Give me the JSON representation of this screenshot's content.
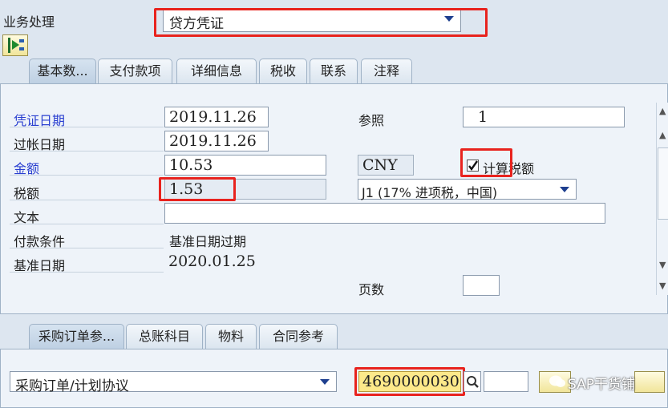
{
  "header": {
    "label": "业务处理",
    "transaction_value": "贷方凭证"
  },
  "tabs_top": [
    {
      "label": "基本数..."
    },
    {
      "label": "支付款项"
    },
    {
      "label": "详细信息"
    },
    {
      "label": "税收"
    },
    {
      "label": "联系"
    },
    {
      "label": "注释"
    }
  ],
  "basic": {
    "doc_date_label": "凭证日期",
    "doc_date": "2019.11.26",
    "post_date_label": "过帐日期",
    "post_date": "2019.11.26",
    "amount_label": "金额",
    "amount": "10.53",
    "currency": "CNY",
    "tax_label": "税额",
    "tax": "1.53",
    "text_label": "文本",
    "text_value": "",
    "payment_terms_label": "付款条件",
    "payment_terms": "基准日期过期",
    "baseline_label": "基准日期",
    "baseline_date": "2020.01.25",
    "ref_label": "参照",
    "ref_value": "1",
    "calc_tax_label": "计算税额",
    "calc_tax_checked": true,
    "tax_code": "J1 (17% 进项税，中国)",
    "page_label": "页数",
    "page_value": ""
  },
  "tabs_bottom": [
    {
      "label": "采购订单参..."
    },
    {
      "label": "总账科目"
    },
    {
      "label": "物料"
    },
    {
      "label": "合同参考"
    }
  ],
  "po": {
    "ref_type": "采购订单/计划协议",
    "po_number": "4690000030",
    "item_value": ""
  },
  "watermark": "SAP干货铺",
  "colors": {
    "highlight": "#e8231e",
    "label_blue": "#2a3fd0",
    "background": "#dde6f0"
  }
}
